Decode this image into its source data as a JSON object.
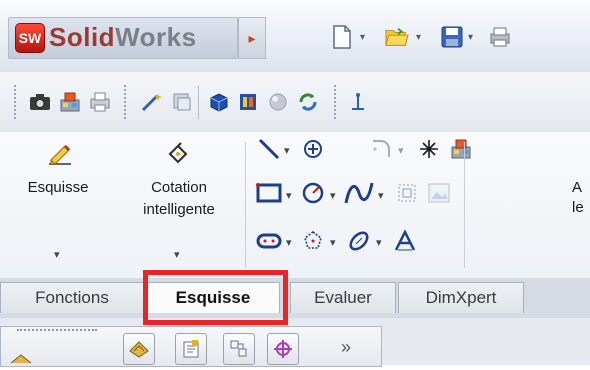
{
  "brand": {
    "badge": "SW",
    "name_part1": "Solid",
    "name_part2": "Works",
    "menu_arrow": "▸"
  },
  "top_toolbar": {
    "icons": [
      "new-document-icon",
      "open-folder-icon",
      "save-disk-icon",
      "print-icon"
    ],
    "dropdown_glyph": "▾"
  },
  "second_toolbar": {
    "icons": [
      "camera-icon",
      "robot-icon",
      "printer-icon",
      "magic-wand-icon",
      "rebuild-icon",
      "blue-cube-icon",
      "texture-icon",
      "sphere-icon",
      "refresh-icon",
      "anchor-icon"
    ]
  },
  "ribbon": {
    "sketch_button": {
      "label": "Esquisse",
      "icon": "pencil-sketch-icon"
    },
    "smart_dimension_button": {
      "label_line1": "Cotation",
      "label_line2": "intelligente",
      "icon": "dimension-icon"
    },
    "partial_label_top": "A",
    "partial_label_bottom": "le",
    "tools_row1": [
      "line-icon",
      "centerpoint-icon",
      "fillet-icon",
      "point-icon",
      "robot-icon"
    ],
    "tools_row2": [
      "rectangle-icon",
      "circle-icon",
      "spline-icon",
      "offset-icon",
      "image-icon"
    ],
    "tools_row3": [
      "slot-icon",
      "polygon-icon",
      "ellipse-icon",
      "text-icon"
    ]
  },
  "tabs": [
    {
      "label": "Fonctions",
      "active": false
    },
    {
      "label": "Esquisse",
      "active": true
    },
    {
      "label": "Evaluer",
      "active": false
    },
    {
      "label": "DimXpert",
      "active": false
    }
  ],
  "feature_panel": {
    "more_glyph": "»",
    "icons": [
      "part-icon",
      "properties-icon",
      "configuration-icon",
      "crosshair-icon"
    ]
  },
  "colors": {
    "highlight": "#e8232a",
    "logo_red": "#c0170d"
  }
}
